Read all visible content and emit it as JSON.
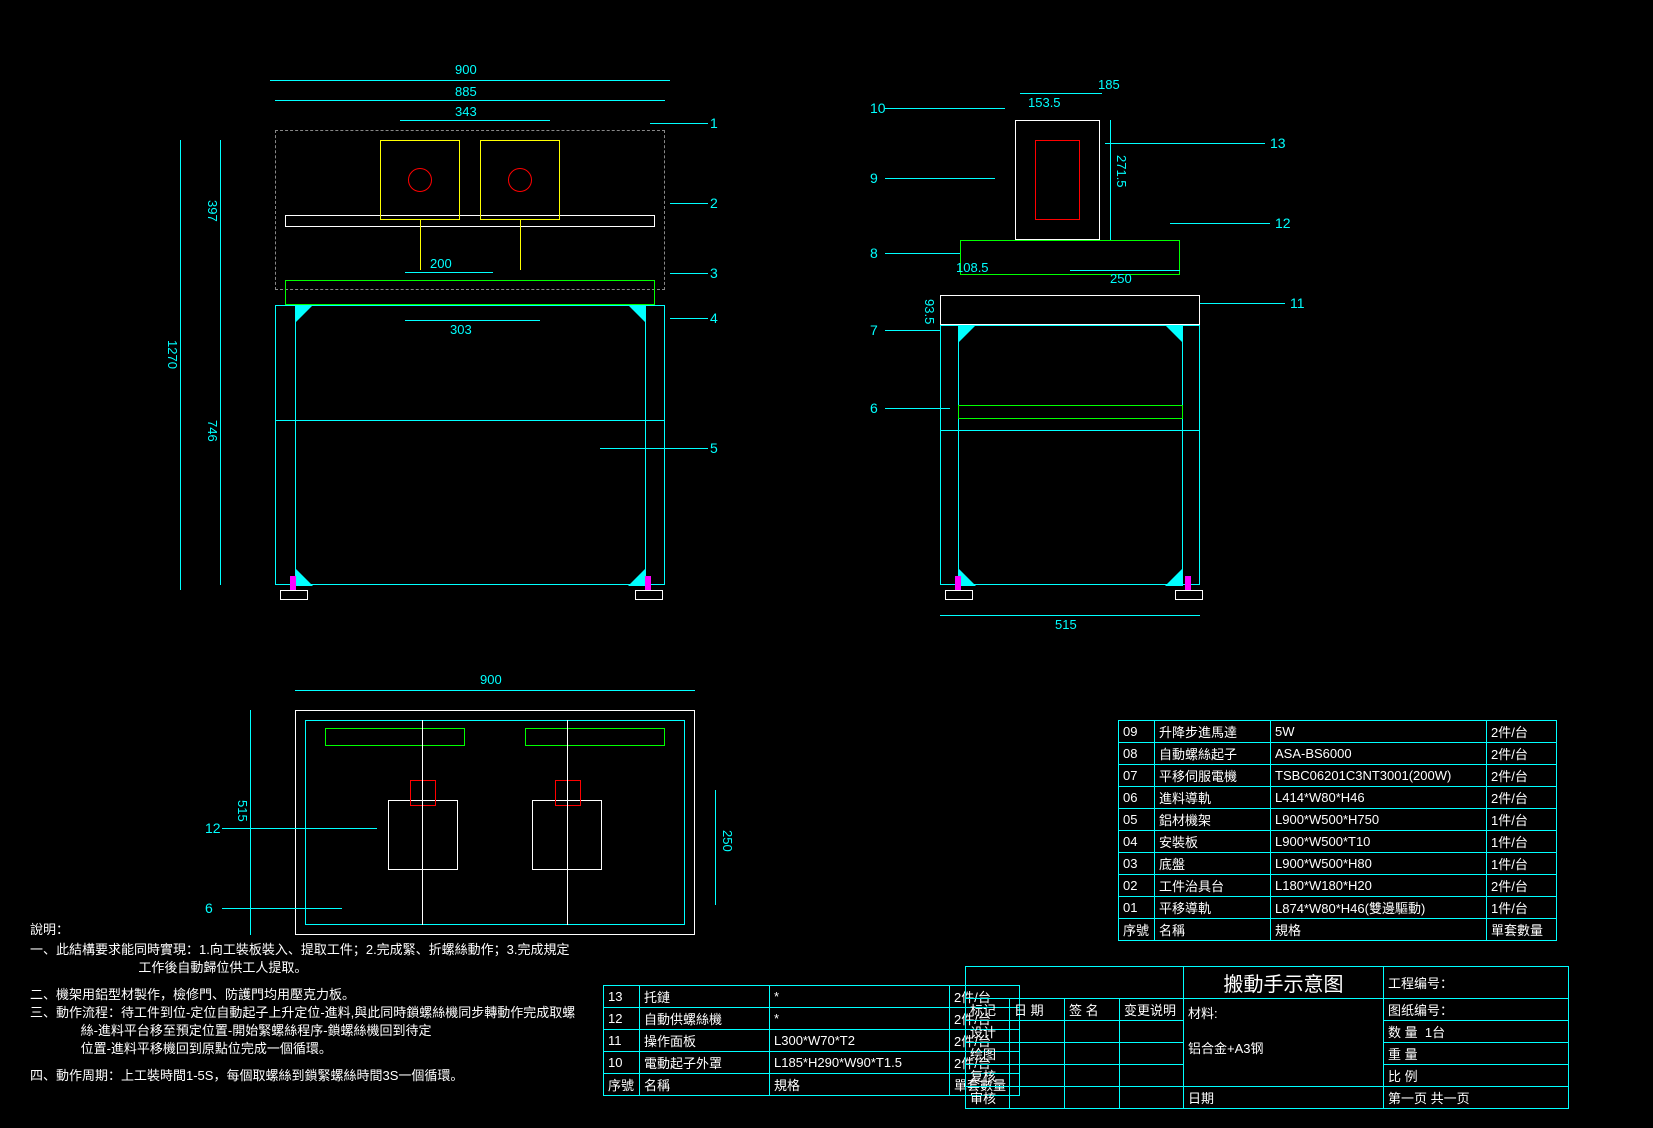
{
  "title": "搬動手示意图",
  "front_view": {
    "outer_width": "900",
    "inner_width": "885",
    "head_span": "343",
    "jig_span": "200",
    "slide_span": "303",
    "frame_width": "900",
    "total_height": "1270",
    "upper_height": "397",
    "lower_height": "746"
  },
  "side_view": {
    "top_width": "185",
    "head_offset": "153.5",
    "head_height": "271.5",
    "bracket_h": "108.5",
    "bracket_w": "250",
    "table_h": "93.5",
    "base_width": "515"
  },
  "top_view": {
    "width": "900",
    "depth": "515",
    "inner_depth": "250"
  },
  "balloons_front": [
    "1",
    "2",
    "3",
    "4",
    "5"
  ],
  "balloons_side": [
    "10",
    "13",
    "9",
    "12",
    "8",
    "11",
    "7",
    "6"
  ],
  "balloons_top": [
    "12",
    "6"
  ],
  "notes": {
    "heading": "說明：",
    "line1": "一、此結構要求能同時實現：1.向工裝板裝入、提取工件；2.完成緊、折螺絲動作；3.完成規定",
    "line1b": "                              工作後自動歸位供工人提取。",
    "line2": "二、機架用鋁型材製作，檢修門、防護門均用壓克力板。",
    "line3": "三、動作流程：待工件到位-定位自動起子上升定位-進料,與此同時鎖螺絲機同步轉動作完成取螺",
    "line3b": "              絲-進料平台移至預定位置-開始緊螺絲程序-鎖螺絲機回到待定",
    "line3c": "              位置-進料平移機回到原點位完成一個循環。",
    "line4": "四、動作周期：上工裝時間1-5S，每個取螺絲到鎖緊螺絲時間3S一個循環。"
  },
  "bom_upper": [
    {
      "no": "09",
      "name": "升降步進馬達",
      "spec": "5W",
      "qty": "2件/台"
    },
    {
      "no": "08",
      "name": "自動螺絲起子",
      "spec": "ASA-BS6000",
      "qty": "2件/台"
    },
    {
      "no": "07",
      "name": "平移伺服電機",
      "spec": "TSBC06201C3NT3001(200W)",
      "qty": "2件/台"
    },
    {
      "no": "06",
      "name": "進料導軌",
      "spec": "L414*W80*H46",
      "qty": "2件/台"
    },
    {
      "no": "05",
      "name": "鋁材機架",
      "spec": "L900*W500*H750",
      "qty": "1件/台"
    },
    {
      "no": "04",
      "name": "安裝板",
      "spec": "L900*W500*T10",
      "qty": "1件/台"
    },
    {
      "no": "03",
      "name": "底盤",
      "spec": "L900*W500*H80",
      "qty": "1件/台"
    },
    {
      "no": "02",
      "name": "工件治具台",
      "spec": "L180*W180*H20",
      "qty": "2件/台"
    },
    {
      "no": "01",
      "name": "平移導軌",
      "spec": "L874*W80*H46(雙邊驅動)",
      "qty": "1件/台"
    }
  ],
  "bom_upper_hdr": {
    "no": "序號",
    "name": "名稱",
    "spec": "規格",
    "qty": "單套數量"
  },
  "bom_lower": [
    {
      "no": "13",
      "name": "托鏈",
      "spec": "*",
      "qty": "2件/台"
    },
    {
      "no": "12",
      "name": "自動供螺絲機",
      "spec": "*",
      "qty": "2件/台"
    },
    {
      "no": "11",
      "name": "操作面板",
      "spec": "L300*W70*T2",
      "qty": "2件/台"
    },
    {
      "no": "10",
      "name": "電動起子外罩",
      "spec": "L185*H290*W90*T1.5",
      "qty": "2件/台"
    }
  ],
  "bom_lower_hdr": {
    "no": "序號",
    "name": "名稱",
    "spec": "規格",
    "qty": "單套數量"
  },
  "titleblock": {
    "row1": {
      "mark": "标记",
      "date": "日 期",
      "sign": "签 名",
      "change": "变更说明"
    },
    "row2": {
      "design": "设计"
    },
    "row3": {
      "draw": "绘图"
    },
    "row4": {
      "review": "复核"
    },
    "row5": {
      "audit": "审核"
    },
    "material_lbl": "材料:",
    "material_val": "铝合金+A3钢",
    "date_lbl": "日期",
    "project_lbl": "工程编号：",
    "drawing_lbl": "图纸编号：",
    "qty_lbl": "数 量",
    "qty_val": "1台",
    "weight_lbl": "重 量",
    "scale_lbl": "比 例",
    "page": "第一页 共一页"
  }
}
